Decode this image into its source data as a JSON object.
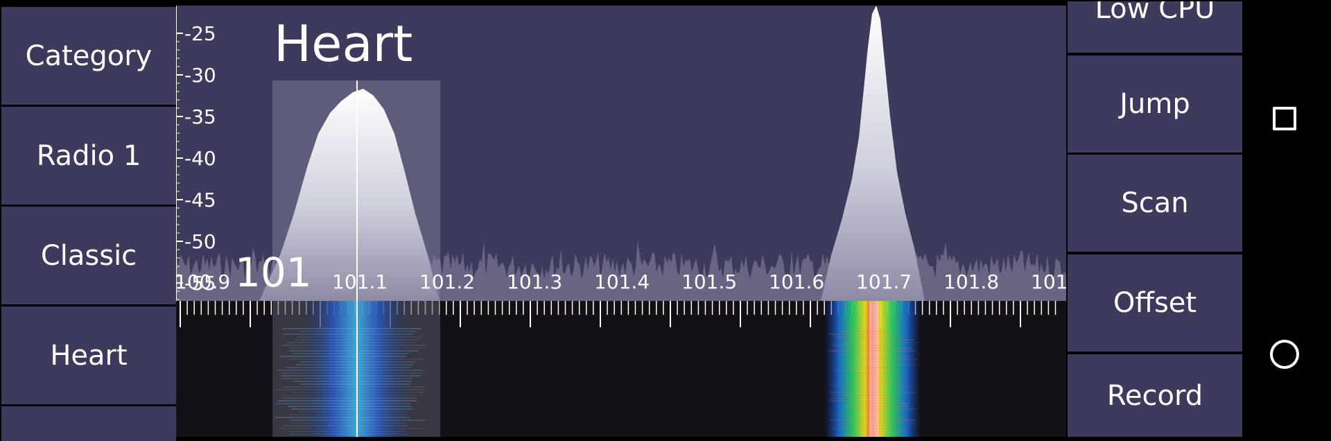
{
  "left_buttons": [
    {
      "label": "Category"
    },
    {
      "label": "Radio 1"
    },
    {
      "label": "Classic"
    },
    {
      "label": "Heart"
    },
    {
      "label": ""
    }
  ],
  "right_buttons": [
    {
      "label": "Low CPU"
    },
    {
      "label": "Jump"
    },
    {
      "label": "Scan"
    },
    {
      "label": "Offset"
    },
    {
      "label": "Record"
    }
  ],
  "spectrum": {
    "station_label": "Heart",
    "big_freq_label": "101",
    "db_ticks": [
      "-25",
      "-30",
      "-35",
      "-40",
      "-45",
      "-50",
      "-55"
    ],
    "freq_ticks": [
      "100.9",
      "101.1",
      "101.2",
      "101.3",
      "101.4",
      "101.5",
      "101.6",
      "101.7",
      "101.8",
      "101."
    ],
    "colors": {
      "panel_bg": "#3e3a5c",
      "waterfall_bg": "#121015",
      "highlight": "#6b6785"
    }
  },
  "nav": {
    "recents_icon": "square-icon",
    "home_icon": "circle-icon"
  }
}
